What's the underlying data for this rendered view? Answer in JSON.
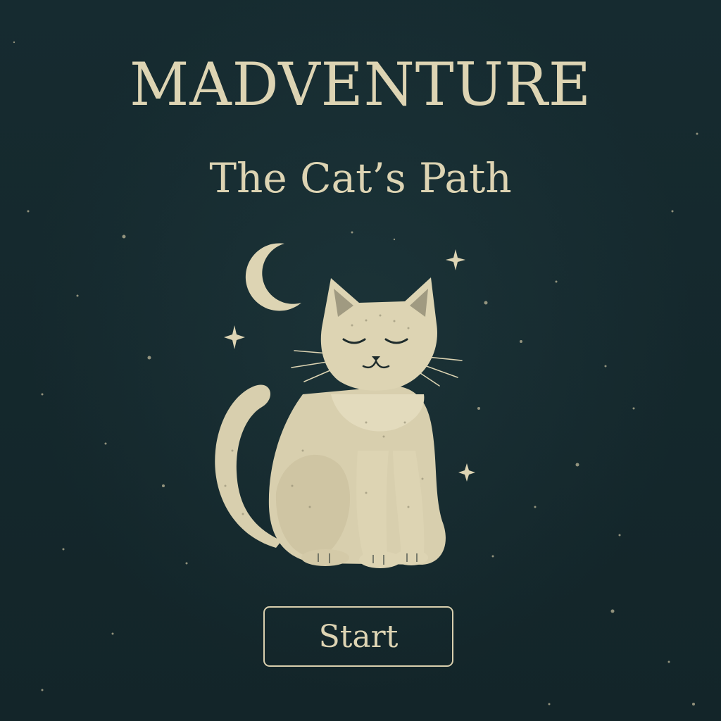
{
  "game": {
    "title": "MADVENTURE",
    "subtitle": "The Cat’s Path",
    "start_label": "Start"
  },
  "illustration": {
    "subject": "sleeping-cat",
    "decorations": [
      "crescent-moon-icon",
      "sparkle-star-icon"
    ]
  },
  "colors": {
    "background": "#15292e",
    "ink": "#ddd4b3"
  }
}
